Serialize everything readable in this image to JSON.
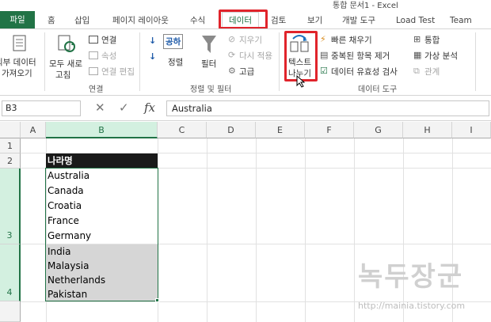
{
  "window": {
    "title": "통합 문서1 - Excel"
  },
  "tabs": {
    "file": "파일",
    "home": "홈",
    "insert": "삽입",
    "layout": "페이지 레이아웃",
    "formulas": "수식",
    "data": "데이터",
    "review": "검토",
    "view": "보기",
    "developer": "개발 도구",
    "loadtest": "Load Test",
    "team": "Team"
  },
  "ribbon": {
    "external": {
      "line1": "외부 데이터",
      "line2": "가져오기"
    },
    "refresh": {
      "line1": "모두 새로",
      "line2": "고침"
    },
    "connections": "연결",
    "properties": "속성",
    "edit_links": "연결 편집",
    "group_connections": "연결",
    "sort_az": "공하",
    "sort": "정렬",
    "filter": "필터",
    "clear": "지우기",
    "reapply": "다시 적용",
    "advanced": "고급",
    "group_sort": "정렬 및 필터",
    "text_to_columns": {
      "line1": "텍스트",
      "line2": "나누기"
    },
    "flash_fill": "빠른 채우기",
    "remove_duplicates": "중복된 항목 제거",
    "data_validation": "데이터 유효성 검사",
    "consolidate": "통합",
    "what_if": "가상 분석",
    "relationships": "관계",
    "group_data_tools": "데이터 도구"
  },
  "formula_bar": {
    "name_box": "B3",
    "cancel": "✕",
    "enter": "✓",
    "fx": "fx",
    "value": "Australia"
  },
  "columns": [
    "A",
    "B",
    "C",
    "D",
    "E",
    "F",
    "G",
    "H",
    "I"
  ],
  "rows": [
    "1",
    "2",
    "3",
    "4"
  ],
  "header_cell": "나라명",
  "cells": [
    "Australia",
    "Canada",
    "Croatia",
    "France",
    "Germany",
    "India",
    "Malaysia",
    "Netherlands",
    "Pakistan"
  ],
  "watermark": {
    "text": "녹두장군",
    "url": "http://mainia.tistory.com"
  },
  "colors": {
    "excel_green": "#217346",
    "highlight": "#e0242b"
  }
}
